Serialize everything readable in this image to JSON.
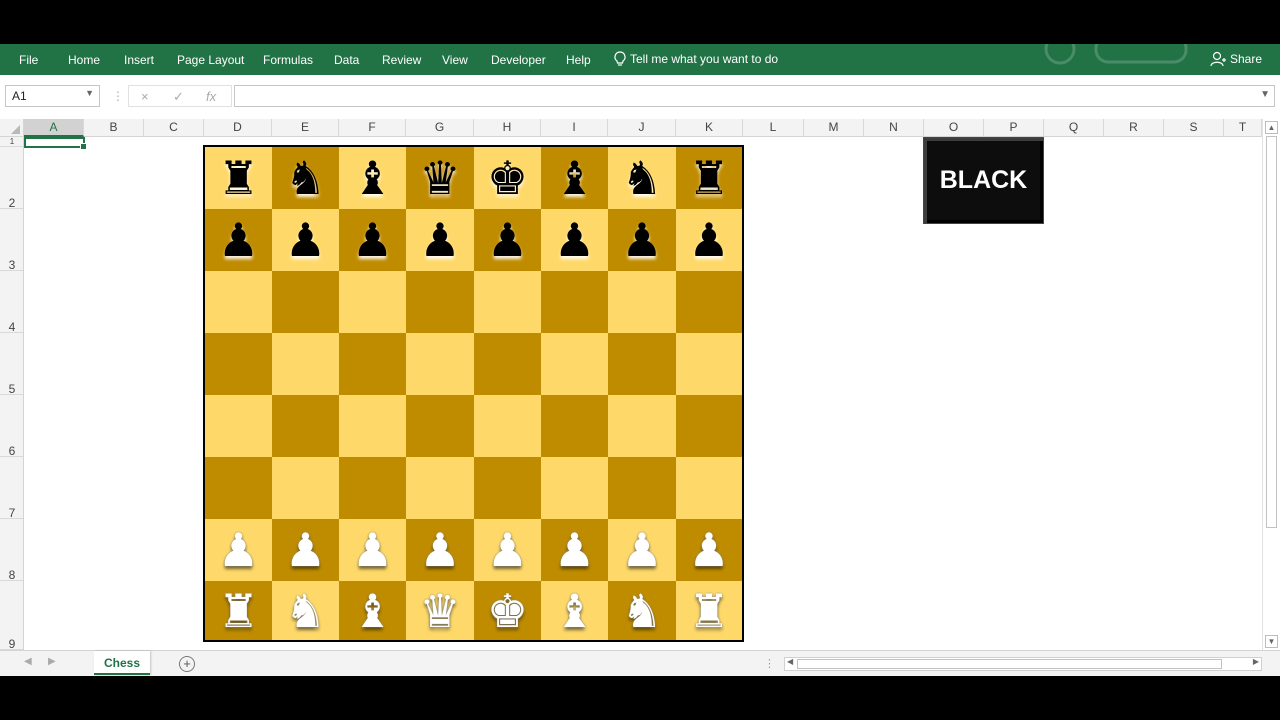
{
  "ribbon": {
    "tabs": [
      "File",
      "Home",
      "Insert",
      "Page Layout",
      "Formulas",
      "Data",
      "Review",
      "View",
      "Developer",
      "Help"
    ],
    "tell_me": "Tell me what you want to do",
    "share": "Share"
  },
  "formula_bar": {
    "name_box": "A1",
    "cancel_icon": "×",
    "enter_icon": "✓",
    "fx_label": "fx",
    "content": ""
  },
  "columns": [
    "A",
    "B",
    "C",
    "D",
    "E",
    "F",
    "G",
    "H",
    "I",
    "J",
    "K",
    "L",
    "M",
    "N",
    "O",
    "P",
    "Q",
    "R",
    "S",
    "T"
  ],
  "rows": [
    "1",
    "2",
    "3",
    "4",
    "5",
    "6",
    "7",
    "8",
    "9"
  ],
  "active_cell": "A1",
  "board": {
    "light_color": "#fed96a",
    "dark_color": "#bf8c00",
    "ranks": [
      [
        "r",
        "n",
        "b",
        "q",
        "k",
        "b",
        "n",
        "r"
      ],
      [
        "p",
        "p",
        "p",
        "p",
        "p",
        "p",
        "p",
        "p"
      ],
      [
        "",
        "",
        "",
        "",
        "",
        "",
        "",
        ""
      ],
      [
        "",
        "",
        "",
        "",
        "",
        "",
        "",
        ""
      ],
      [
        "",
        "",
        "",
        "",
        "",
        "",
        "",
        ""
      ],
      [
        "",
        "",
        "",
        "",
        "",
        "",
        "",
        ""
      ],
      [
        "P",
        "P",
        "P",
        "P",
        "P",
        "P",
        "P",
        "P"
      ],
      [
        "R",
        "N",
        "B",
        "Q",
        "K",
        "B",
        "N",
        "R"
      ]
    ]
  },
  "turn_button": {
    "label": "BLACK"
  },
  "sheet_tabs": {
    "active": "Chess"
  },
  "colors": {
    "excel_green": "#217346"
  }
}
